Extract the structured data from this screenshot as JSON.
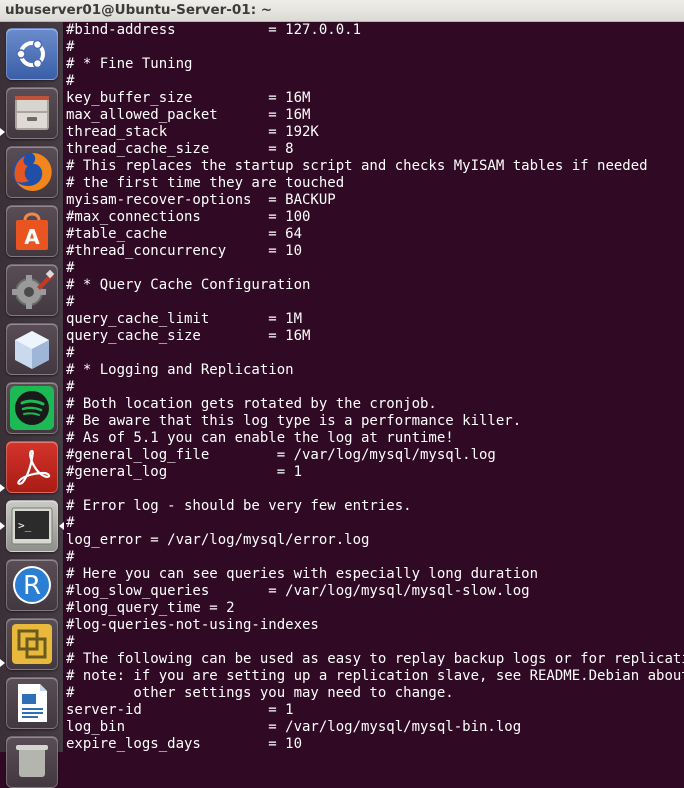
{
  "window": {
    "title": "ubuserver01@Ubuntu-Server-01: ~"
  },
  "launcher": {
    "items": [
      {
        "name": "ubuntu-dash-icon"
      },
      {
        "name": "files-icon"
      },
      {
        "name": "firefox-icon"
      },
      {
        "name": "software-center-icon"
      },
      {
        "name": "system-settings-icon"
      },
      {
        "name": "virtualbox-icon"
      },
      {
        "name": "spotify-icon"
      },
      {
        "name": "pdf-reader-icon"
      },
      {
        "name": "terminal-icon"
      },
      {
        "name": "r-studio-icon"
      },
      {
        "name": "vmware-icon"
      },
      {
        "name": "libreoffice-writer-icon"
      },
      {
        "name": "trash-icon"
      }
    ]
  },
  "terminal": {
    "lines": [
      "#bind-address           = 127.0.0.1",
      "#",
      "# * Fine Tuning",
      "#",
      "key_buffer_size         = 16M",
      "max_allowed_packet      = 16M",
      "thread_stack            = 192K",
      "thread_cache_size       = 8",
      "# This replaces the startup script and checks MyISAM tables if needed",
      "# the first time they are touched",
      "myisam-recover-options  = BACKUP",
      "#max_connections        = 100",
      "#table_cache            = 64",
      "#thread_concurrency     = 10",
      "#",
      "# * Query Cache Configuration",
      "#",
      "query_cache_limit       = 1M",
      "query_cache_size        = 16M",
      "#",
      "# * Logging and Replication",
      "#",
      "# Both location gets rotated by the cronjob.",
      "# Be aware that this log type is a performance killer.",
      "# As of 5.1 you can enable the log at runtime!",
      "#general_log_file        = /var/log/mysql/mysql.log",
      "#general_log             = 1",
      "#",
      "# Error log - should be very few entries.",
      "#",
      "log_error = /var/log/mysql/error.log",
      "#",
      "# Here you can see queries with especially long duration",
      "#log_slow_queries       = /var/log/mysql/mysql-slow.log",
      "#long_query_time = 2",
      "#log-queries-not-using-indexes",
      "#",
      "# The following can be used as easy to replay backup logs or for replication.",
      "# note: if you are setting up a replication slave, see README.Debian about",
      "#       other settings you may need to change.",
      "server-id               = 1",
      "log_bin                 = /var/log/mysql/mysql-bin.log",
      "expire_logs_days        = 10"
    ]
  }
}
